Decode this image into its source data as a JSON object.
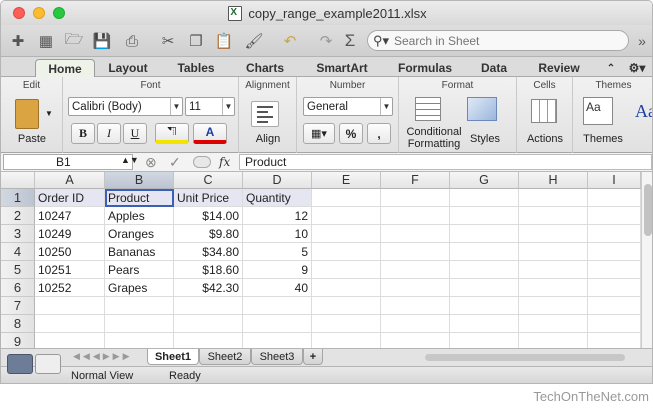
{
  "window": {
    "title": "copy_range_example2011.xlsx"
  },
  "toolbar": {
    "icons": [
      "new-sheet-icon",
      "gallery-icon",
      "open-icon",
      "save-icon",
      "print-icon",
      "cut-icon",
      "copy-icon",
      "paste-icon",
      "format-painter-icon",
      "undo-icon",
      "redo-icon",
      "autosum-icon"
    ],
    "search_placeholder": "Search in Sheet"
  },
  "ribbon_tabs": [
    "Home",
    "Layout",
    "Tables",
    "Charts",
    "SmartArt",
    "Formulas",
    "Data",
    "Review"
  ],
  "ribbon": {
    "edit": {
      "label": "Edit",
      "paste": "Paste"
    },
    "font": {
      "label": "Font",
      "family": "Calibri (Body)",
      "size": "11",
      "bold": "B",
      "italic": "I",
      "underline": "U",
      "color_a": "A"
    },
    "alignment": {
      "label": "Alignment",
      "align": "Align"
    },
    "number": {
      "label": "Number",
      "format": "General",
      "percent": "%",
      "comma": ","
    },
    "format": {
      "label": "Format",
      "cond1": "Conditional",
      "cond2": "Formatting",
      "styles": "Styles"
    },
    "cells": {
      "label": "Cells",
      "actions": "Actions"
    },
    "themes": {
      "label": "Themes",
      "themes": "Themes",
      "aa": "Aa"
    }
  },
  "formula_bar": {
    "cell_ref": "B1",
    "fx": "fx",
    "value": "Product"
  },
  "columns": [
    "A",
    "B",
    "C",
    "D",
    "E",
    "F",
    "G",
    "H",
    "I"
  ],
  "rows": [
    "1",
    "2",
    "3",
    "4",
    "5",
    "6",
    "7",
    "8",
    "9"
  ],
  "table": {
    "headers": [
      "Order ID",
      "Product",
      "Unit Price",
      "Quantity"
    ],
    "rows": [
      [
        "10247",
        "Apples",
        "$14.00",
        "12"
      ],
      [
        "10249",
        "Oranges",
        "$9.80",
        "10"
      ],
      [
        "10250",
        "Bananas",
        "$34.80",
        "5"
      ],
      [
        "10251",
        "Pears",
        "$18.60",
        "9"
      ],
      [
        "10252",
        "Grapes",
        "$42.30",
        "40"
      ]
    ]
  },
  "sheets": [
    "Sheet1",
    "Sheet2",
    "Sheet3"
  ],
  "add_sheet": "+",
  "status": {
    "view": "Normal View",
    "state": "Ready"
  },
  "credit": "TechOnTheNet.com"
}
